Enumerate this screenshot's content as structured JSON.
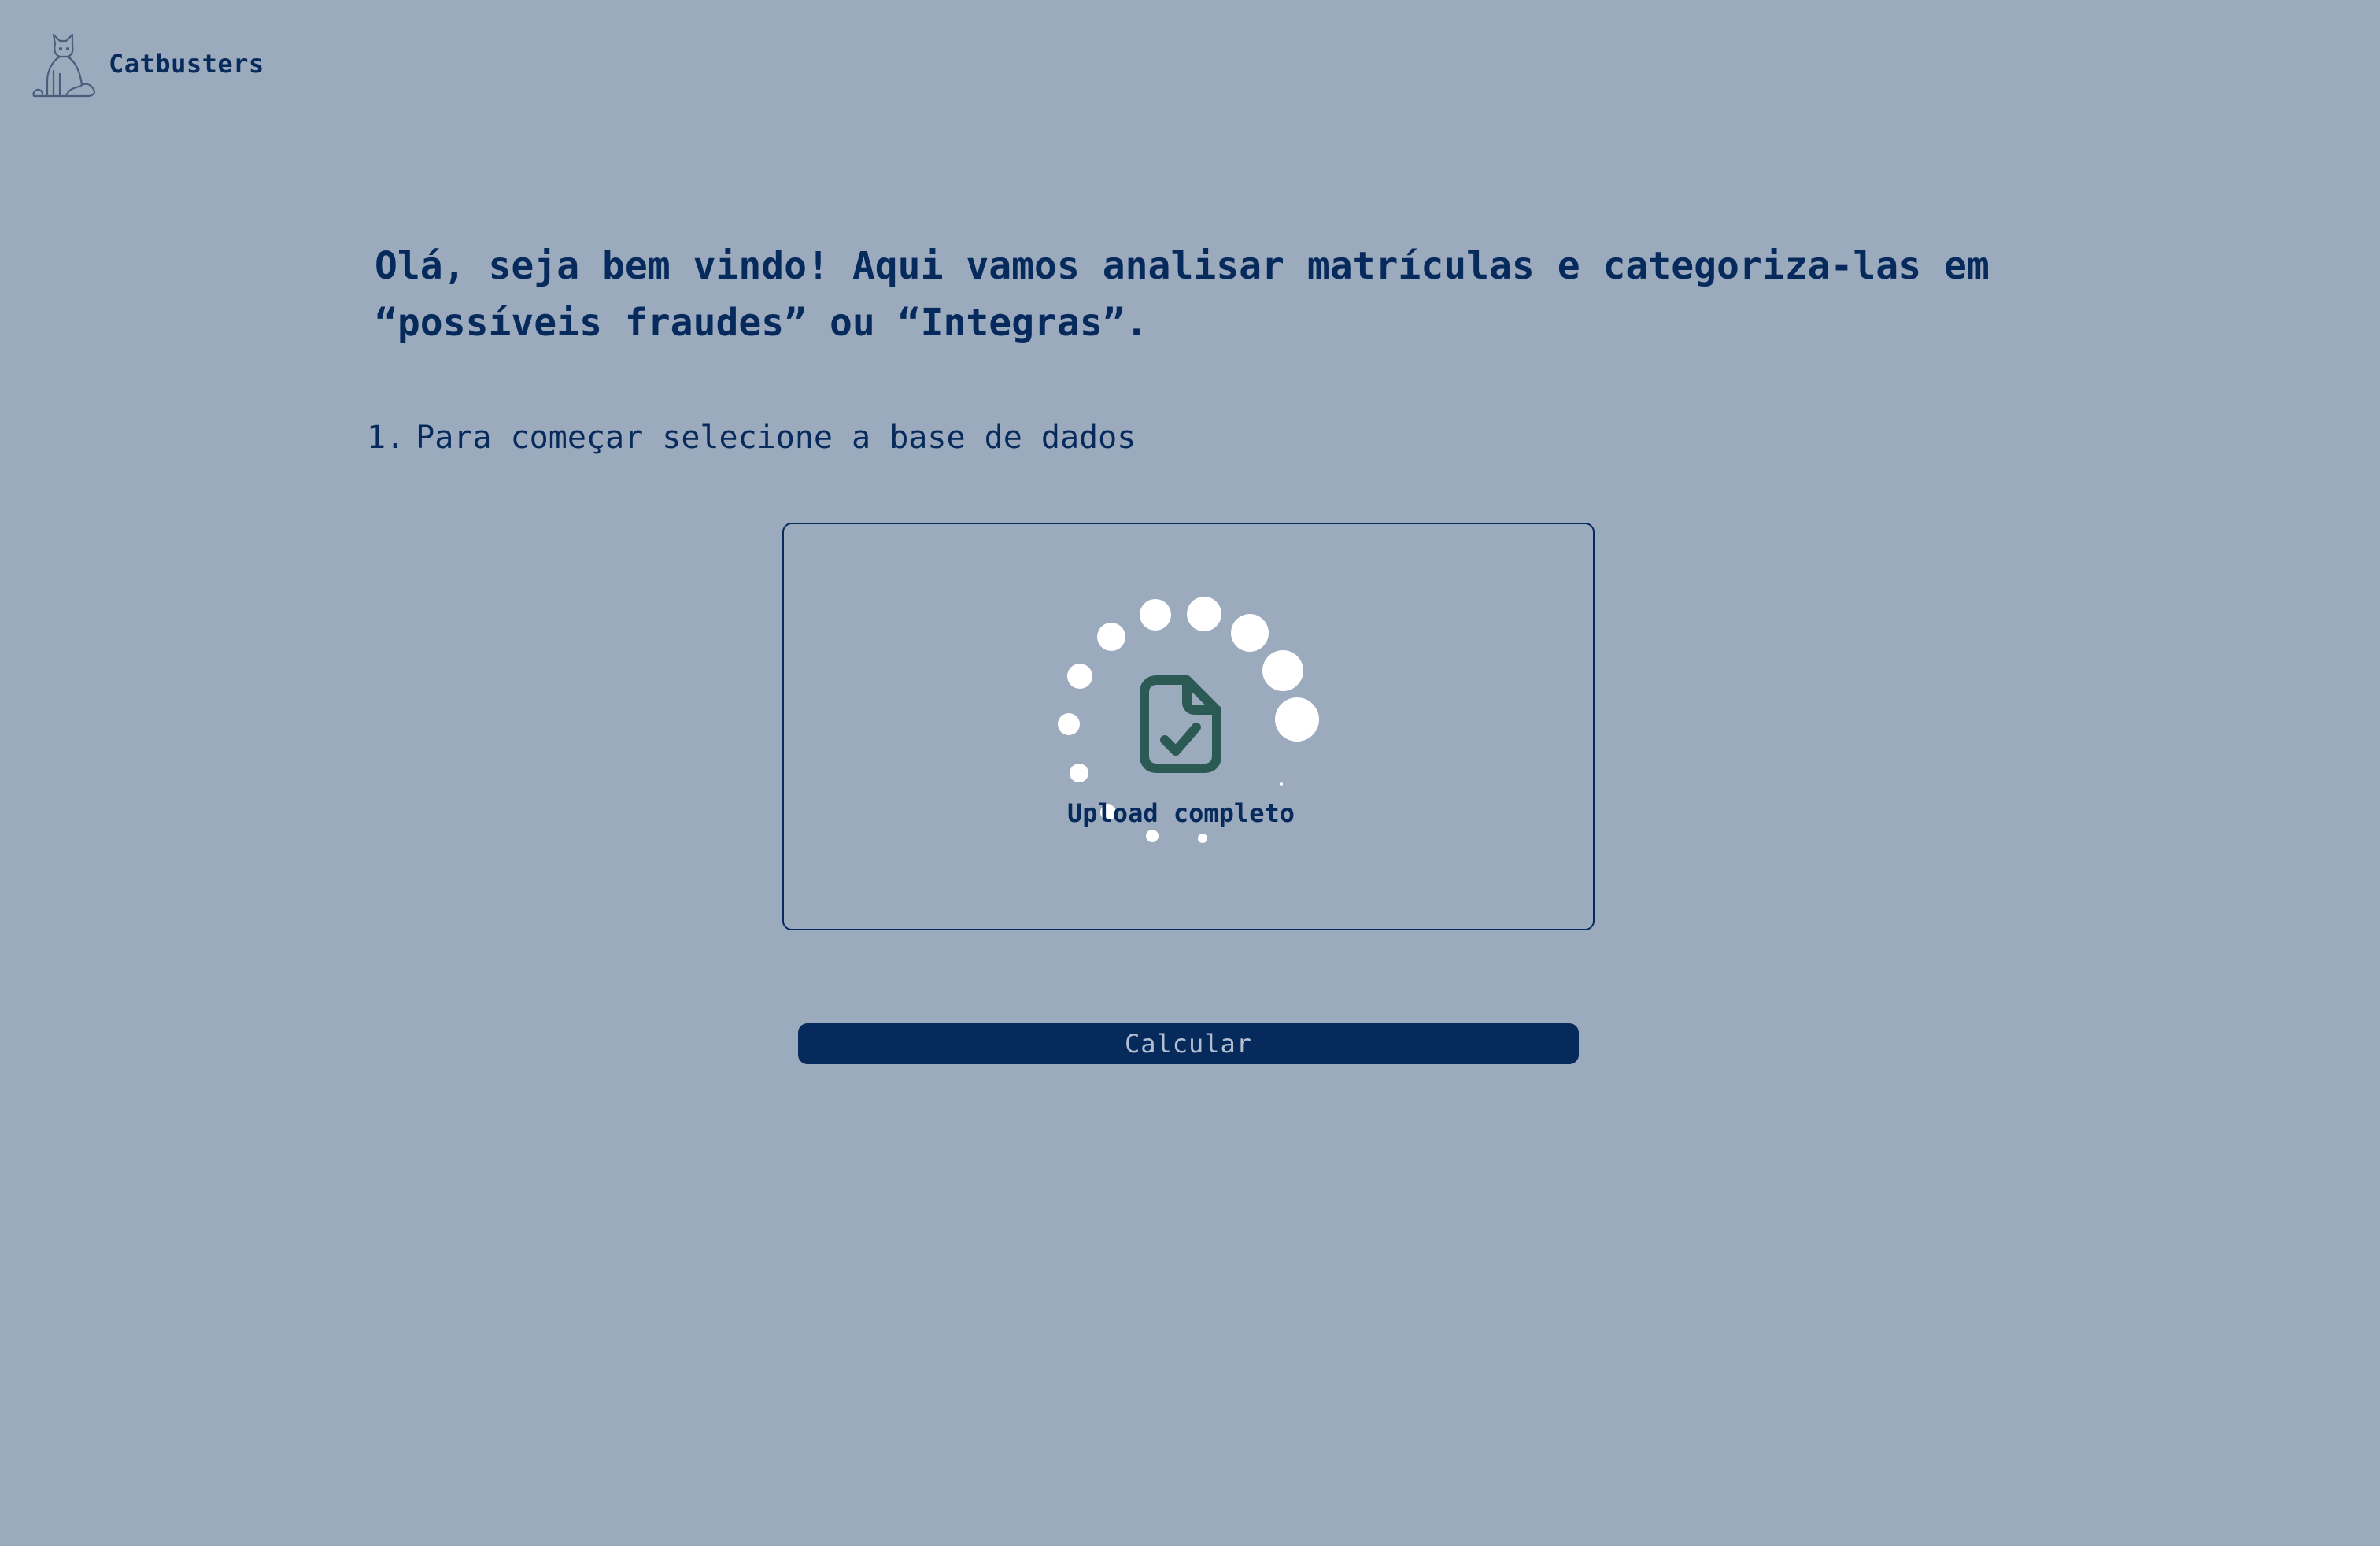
{
  "header": {
    "brand_name": "Catbusters",
    "logo_icon": "cat-logo-icon"
  },
  "main": {
    "welcome_text": "Olá, seja bem vindo! Aqui vamos analisar matrículas e categoriza-las em “possíveis fraudes” ou “Integras”.",
    "step_number": "1.",
    "step_text": "Para começar selecione a base de dados"
  },
  "upload": {
    "status_text": "Upload completo",
    "status_icon": "file-check-icon",
    "loader_icon": "dots-spinner-icon"
  },
  "actions": {
    "calculate_label": "Calcular"
  },
  "colors": {
    "background": "#9caabd",
    "primary": "#062a5c",
    "icon_green": "#2b5a55",
    "spinner_dots": "#ffffff",
    "button_text": "#b3bfcf"
  }
}
